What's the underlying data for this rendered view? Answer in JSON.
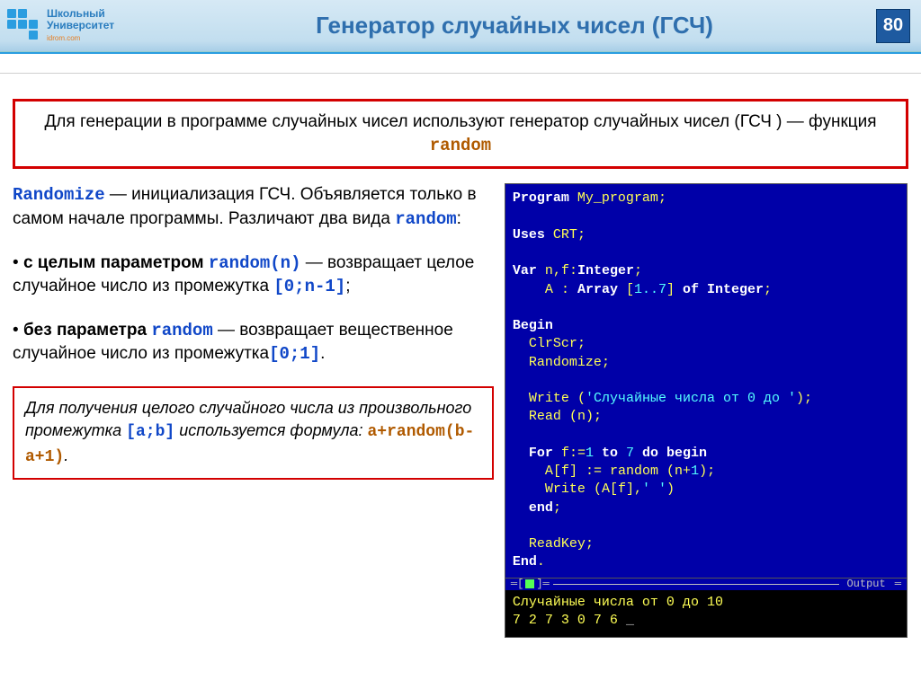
{
  "header": {
    "logo_line1": "Школьный",
    "logo_line2": "Университет",
    "logo_sub": "idrom.com",
    "title": "Генератор случайных чисел  (ГСЧ)",
    "page_number": "80"
  },
  "intro": {
    "text1": "Для генерации в программе случайных чисел используют генератор случайных чисел (ГСЧ ) — функция ",
    "kw": "random"
  },
  "left": {
    "p1_kw": "Randomize",
    "p1_rest": "  —   инициализация ГСЧ. Объявляется только в самом начале программы. Различают два вида ",
    "p1_kw2": "random",
    "p1_end": ":",
    "p2_lead": "• ",
    "p2_bold": "с целым параметром ",
    "p2_kw": "random(n)",
    "p2_rest": " — возвращает целое случайное число из промежутка ",
    "p2_range": "[0;n-1]",
    "p2_end": ";",
    "p3_lead": "• ",
    "p3_bold": "без параметра ",
    "p3_kw": "random",
    "p3_rest": " — возвращает вещественное случайное число из промежутка",
    "p3_range": "[0;1]",
    "p3_end": ".",
    "formula_text1": "Для получения целого случайного числа из произвольного промежутка ",
    "formula_range": "[a;b]",
    "formula_text2": " используется формула: ",
    "formula_expr": "a+random(b-a+1)",
    "formula_end": "."
  },
  "code": {
    "l1a": "Program ",
    "l1b": "My_program",
    "l1c": ";",
    "l2": "",
    "l3a": "Uses ",
    "l3b": "CRT",
    "l3c": ";",
    "l4": "",
    "l5a": "Var ",
    "l5b": "n",
    "l5c": ",",
    "l5d": "f",
    "l5e": ":",
    "l5f": "Integer",
    "l5g": ";",
    "l6a": "    ",
    "l6b": "A",
    "l6c": " : ",
    "l6d": "Array ",
    "l6e": "[",
    "l6f": "1..7",
    "l6g": "]",
    "l6h": " of ",
    "l6i": "Integer",
    "l6j": ";",
    "l7": "",
    "l8": "Begin",
    "l9a": "  ",
    "l9b": "ClrScr",
    "l9c": ";",
    "l10a": "  ",
    "l10b": "Randomize",
    "l10c": ";",
    "l11": "",
    "l12a": "  ",
    "l12b": "Write",
    "l12c": " (",
    "l12d": "'Случайные числа от 0 до '",
    "l12e": ");",
    "l13a": "  ",
    "l13b": "Read",
    "l13c": " (",
    "l13d": "n",
    "l13e": ");",
    "l14": "",
    "l15a": "  ",
    "l15b": "For ",
    "l15c": "f",
    "l15d": ":=",
    "l15e": "1",
    "l15f": " to ",
    "l15g": "7",
    "l15h": " do begin",
    "l16a": "    ",
    "l16b": "A",
    "l16c": "[",
    "l16d": "f",
    "l16e": "]",
    "l16f": " := ",
    "l16g": "random",
    "l16h": " (",
    "l16i": "n",
    "l16j": "+",
    "l16k": "1",
    "l16l": ");",
    "l17a": "    ",
    "l17b": "Write",
    "l17c": " (",
    "l17d": "A",
    "l17e": "[",
    "l17f": "f",
    "l17g": "]",
    "l17h": ",",
    "l17i": "' '",
    "l17j": ")",
    "l18a": "  ",
    "l18b": "end",
    "l18c": ";",
    "l19": "",
    "l20a": "  ",
    "l20b": "ReadKey",
    "l20c": ";",
    "l21a": "End",
    "l21b": "."
  },
  "divider": {
    "output_label": "Output"
  },
  "output": {
    "line1": "Случайные числа от 0 до 10",
    "line2": "7 2 7 3 0 7 6 ",
    "cursor": "_"
  }
}
